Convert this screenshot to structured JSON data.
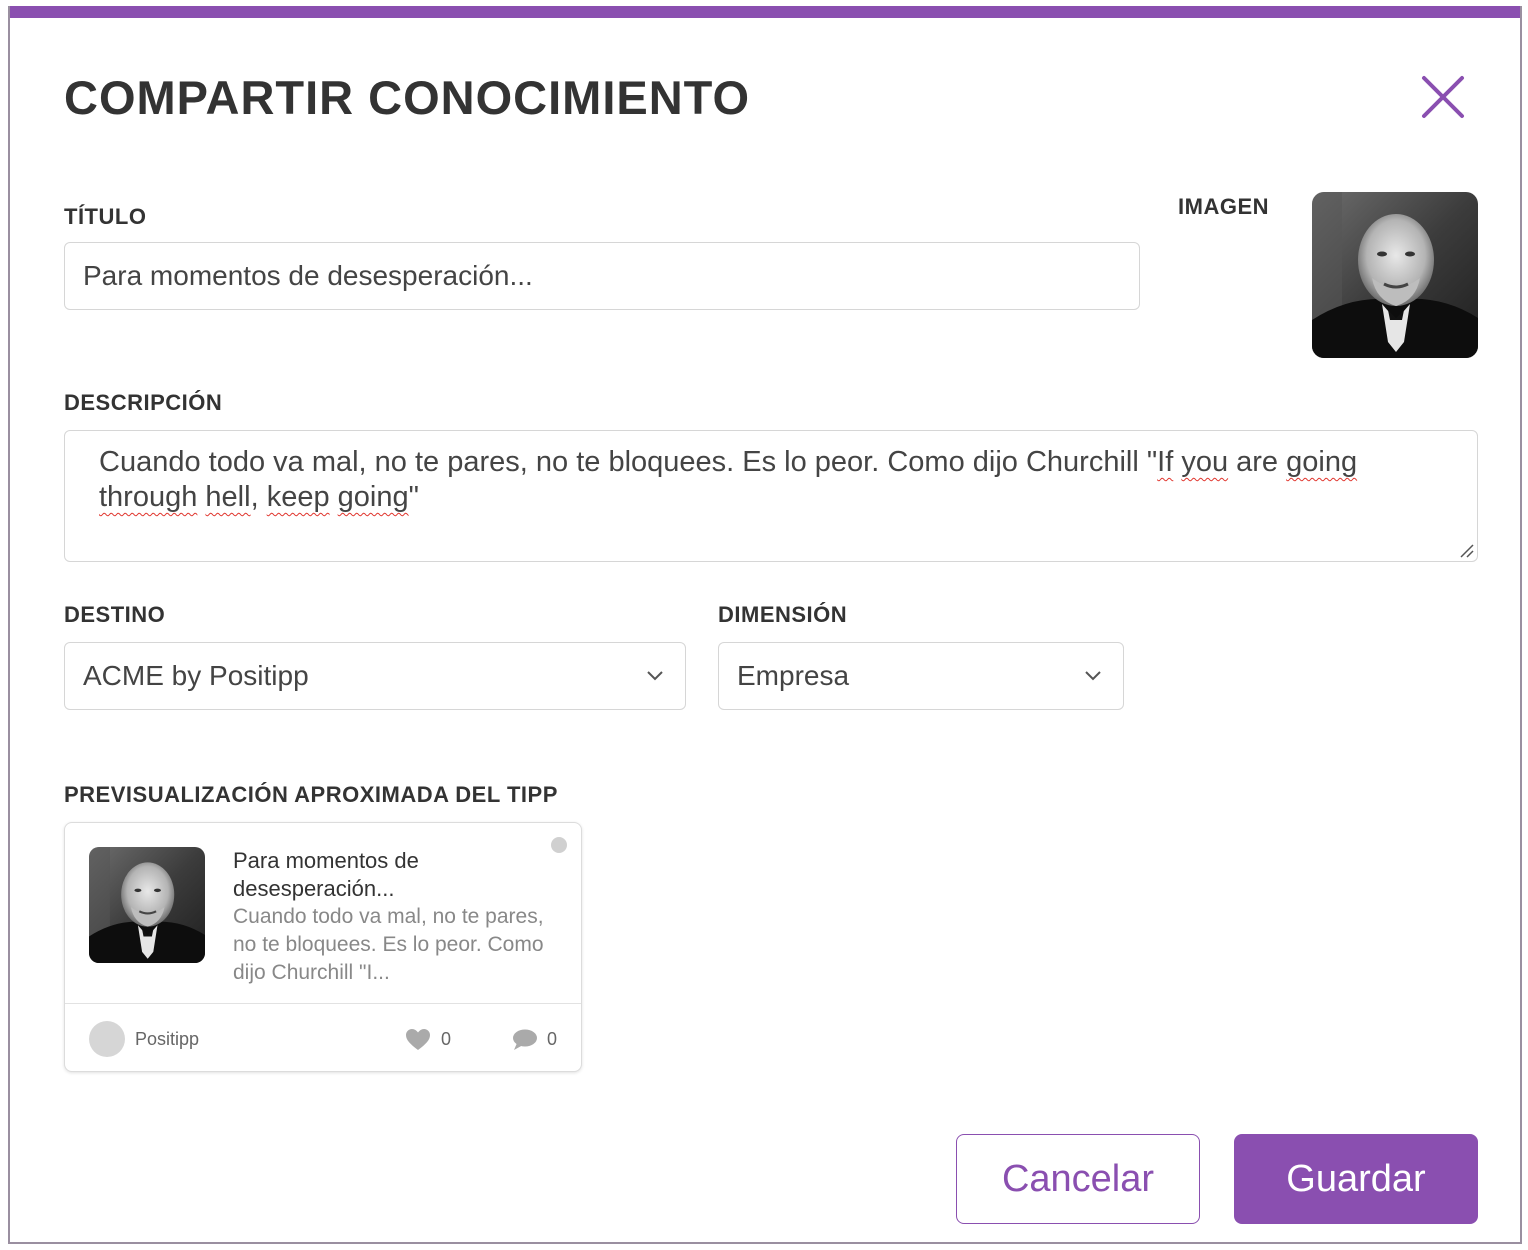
{
  "modal": {
    "title": "COMPARTIR CONOCIMIENTO",
    "accent_color": "#8a4fb0",
    "close_icon": "close-icon"
  },
  "form": {
    "title_label": "TÍTULO",
    "title_value": "Para momentos de desesperación...",
    "image_label": "IMAGEN",
    "description_label": "DESCRIPCIÓN",
    "description_parts": {
      "before": "Cuando todo va mal, no te pares, no te bloquees. Es lo peor. Como dijo Churchill \"",
      "w1": "If",
      "s1": " ",
      "w2": "you",
      "s2": " are ",
      "w3": "going",
      "s3": " ",
      "w4": "through",
      "s4": " ",
      "w5": "hell",
      "s5": ", ",
      "w6": "keep",
      "s6": " ",
      "w7": "going",
      "after": "\""
    },
    "destino_label": "DESTINO",
    "destino_value": "ACME by Positipp",
    "dimension_label": "DIMENSIÓN",
    "dimension_value": "Empresa"
  },
  "preview": {
    "label": "PREVISUALIZACIÓN APROXIMADA DEL TIPP",
    "title": "Para momentos de desesperación...",
    "description": "Cuando todo va mal, no te pares, no te bloquees. Es lo peor. Como dijo Churchill \"I...",
    "author": "Positipp",
    "likes": "0",
    "comments": "0"
  },
  "buttons": {
    "cancel": "Cancelar",
    "save": "Guardar"
  }
}
